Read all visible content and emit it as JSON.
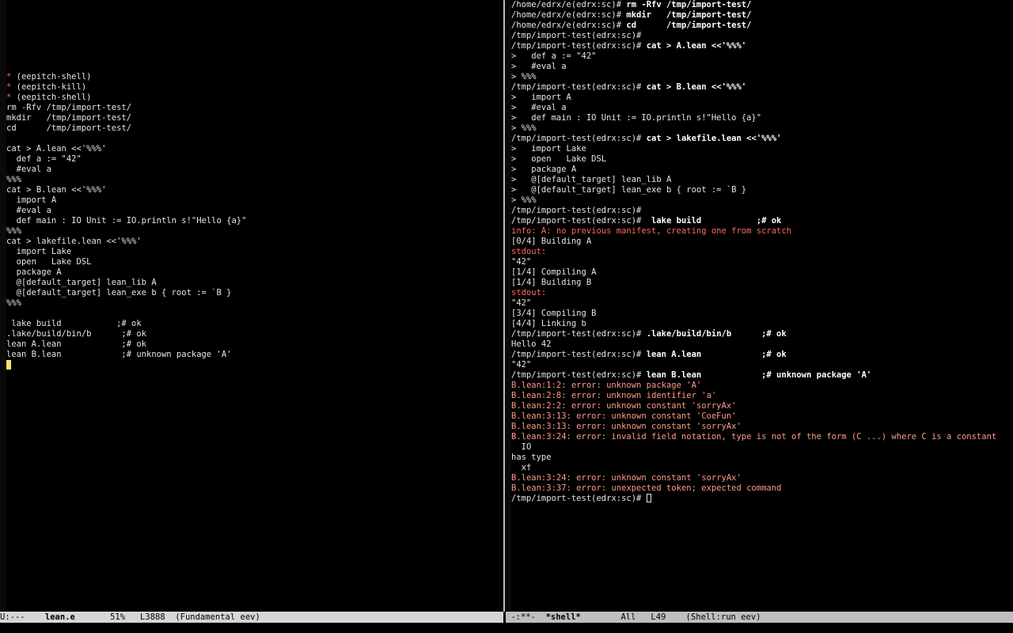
{
  "left_window": {
    "lines": [
      "",
      "",
      "",
      "",
      "",
      "",
      "",
      "* (eepitch-shell)",
      "* (eepitch-kill)",
      "* (eepitch-shell)",
      "rm -Rfv /tmp/import-test/",
      "mkdir   /tmp/import-test/",
      "cd      /tmp/import-test/",
      "",
      "cat > A.lean <<'%%%'",
      "  def a := \"42\"",
      "  #eval a",
      "%%%",
      "cat > B.lean <<'%%%'",
      "  import A",
      "  #eval a",
      "  def main : IO Unit := IO.println s!\"Hello {a}\"",
      "%%%",
      "cat > lakefile.lean <<'%%%'",
      "  import Lake",
      "  open   Lake DSL",
      "  package A",
      "  @[default_target] lean_lib A",
      "  @[default_target] lean_exe b { root := `B }",
      "%%%",
      "",
      " lake build           ;# ok",
      ".lake/build/bin/b      ;# ok",
      "lean A.lean            ;# ok",
      "lean B.lean            ;# unknown package 'A'"
    ],
    "cursor_line": ""
  },
  "right_window": {
    "prompt_home": "/home/edrx/e(edrx:sc)# ",
    "prompt_tmp": "/tmp/import-test(edrx:sc)# ",
    "lines": [
      {
        "p": "home",
        "t": "rm -Rfv /tmp/import-test/"
      },
      {
        "p": "home",
        "t": "mkdir   /tmp/import-test/"
      },
      {
        "p": "home",
        "t": "cd      /tmp/import-test/"
      },
      {
        "p": "tmp",
        "t": ""
      },
      {
        "p": "tmp",
        "t": "cat > A.lean <<'%%%'"
      },
      {
        "c": "plain",
        "t": ">   def a := \"42\""
      },
      {
        "c": "plain",
        "t": ">   #eval a"
      },
      {
        "c": "plain",
        "t": "> %%%"
      },
      {
        "p": "tmp",
        "t": "cat > B.lean <<'%%%'"
      },
      {
        "c": "plain",
        "t": ">   import A"
      },
      {
        "c": "plain",
        "t": ">   #eval a"
      },
      {
        "c": "plain",
        "t": ">   def main : IO Unit := IO.println s!\"Hello {a}\""
      },
      {
        "c": "plain",
        "t": "> %%%"
      },
      {
        "p": "tmp",
        "t": "cat > lakefile.lean <<'%%%'"
      },
      {
        "c": "plain",
        "t": ">   import Lake"
      },
      {
        "c": "plain",
        "t": ">   open   Lake DSL"
      },
      {
        "c": "plain",
        "t": ">   package A"
      },
      {
        "c": "plain",
        "t": ">   @[default_target] lean_lib A"
      },
      {
        "c": "plain",
        "t": ">   @[default_target] lean_exe b { root := `B }"
      },
      {
        "c": "plain",
        "t": "> %%%"
      },
      {
        "p": "tmp",
        "t": ""
      },
      {
        "p": "tmp",
        "t": " lake build           ;# ok"
      },
      {
        "c": "red",
        "t": "info: A: no previous manifest, creating one from scratch"
      },
      {
        "c": "plain",
        "t": "[0/4] Building A"
      },
      {
        "c": "red",
        "t": "stdout:"
      },
      {
        "c": "plain",
        "t": "\"42\""
      },
      {
        "c": "plain",
        "t": "[1/4] Compiling A"
      },
      {
        "c": "plain",
        "t": "[1/4] Building B"
      },
      {
        "c": "red",
        "t": "stdout:"
      },
      {
        "c": "plain",
        "t": "\"42\""
      },
      {
        "c": "plain",
        "t": "[3/4] Compiling B"
      },
      {
        "c": "plain",
        "t": "[4/4] Linking b"
      },
      {
        "p": "tmp",
        "t": ".lake/build/bin/b      ;# ok"
      },
      {
        "c": "plain",
        "t": "Hello 42"
      },
      {
        "p": "tmp",
        "t": "lean A.lean            ;# ok"
      },
      {
        "c": "plain",
        "t": "\"42\""
      },
      {
        "p": "tmp",
        "t": "lean B.lean            ;# unknown package 'A'"
      },
      {
        "c": "err",
        "t": "B.lean:1:2: error: unknown package 'A'"
      },
      {
        "c": "err",
        "t": "B.lean:2:8: error: unknown identifier 'a'"
      },
      {
        "c": "err",
        "t": "B.lean:2:2: error: unknown constant 'sorryAx'"
      },
      {
        "c": "err",
        "t": "B.lean:3:13: error: unknown constant 'CoeFun'"
      },
      {
        "c": "err",
        "t": "B.lean:3:13: error: unknown constant 'sorryAx'"
      },
      {
        "c": "err",
        "t": "B.lean:3:24: error: invalid field notation, type is not of the form (C ...) where C is a constant"
      },
      {
        "c": "plain",
        "t": "  IO"
      },
      {
        "c": "plain",
        "t": "has type"
      },
      {
        "c": "plain",
        "t": "  x†"
      },
      {
        "c": "err",
        "t": "B.lean:3:24: error: unknown constant 'sorryAx'"
      },
      {
        "c": "err",
        "t": "B.lean:3:37: error: unexpected token; expected command"
      }
    ],
    "last_prompt": ""
  },
  "modeline_left": {
    "status": "U:---",
    "buffer": "lean.e",
    "percent": "51%",
    "line": "L3888",
    "mode": "(Fundamental eev)"
  },
  "modeline_right": {
    "status": "-:**-",
    "buffer": "*shell*",
    "percent": "All",
    "line": "L49",
    "mode": "(Shell:run eev)"
  }
}
